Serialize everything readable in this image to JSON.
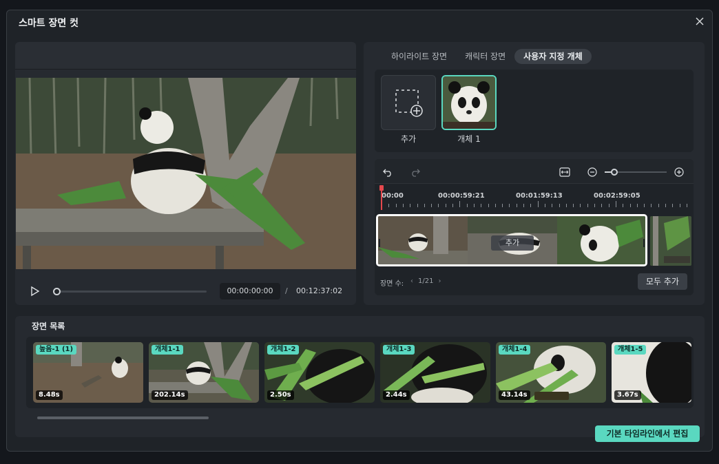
{
  "dialog": {
    "title": "스마트 장면 컷"
  },
  "preview": {
    "current_time": "00:00:00:00",
    "separator": "/",
    "total_time": "00:12:37:02",
    "progress": 0
  },
  "tabs": [
    {
      "label": "하이라이트 장면",
      "active": false
    },
    {
      "label": "캐릭터 장면",
      "active": false
    },
    {
      "label": "사용자 지정 개체",
      "active": true
    }
  ],
  "objects": {
    "add_label": "추가",
    "items": [
      {
        "label": "개체 1"
      }
    ]
  },
  "timeline": {
    "ruler": [
      "00:00",
      "00:00:59:21",
      "00:01:59:13",
      "00:02:59:05"
    ],
    "clip_add_label": "추가",
    "scene_count_label": "장면 수:",
    "prev": "‹",
    "scene_index": "1/21",
    "next": "›",
    "add_all_label": "모두 추가",
    "zoom_level": 0.15
  },
  "scene_list": {
    "title": "장면 목록",
    "items": [
      {
        "tag": "높음-1 (1)",
        "duration": "8.48s"
      },
      {
        "tag": "개체1-1",
        "duration": "202.14s"
      },
      {
        "tag": "개체1-2",
        "duration": "2.50s"
      },
      {
        "tag": "개체1-3",
        "duration": "2.44s"
      },
      {
        "tag": "개체1-4",
        "duration": "43.14s"
      },
      {
        "tag": "개체1-5",
        "duration": "3.67s"
      }
    ],
    "edit_button": "기본 타임라인에서 편집"
  },
  "colors": {
    "accent": "#5ad8c0",
    "playhead": "#e5484d",
    "panel": "#262a30"
  }
}
